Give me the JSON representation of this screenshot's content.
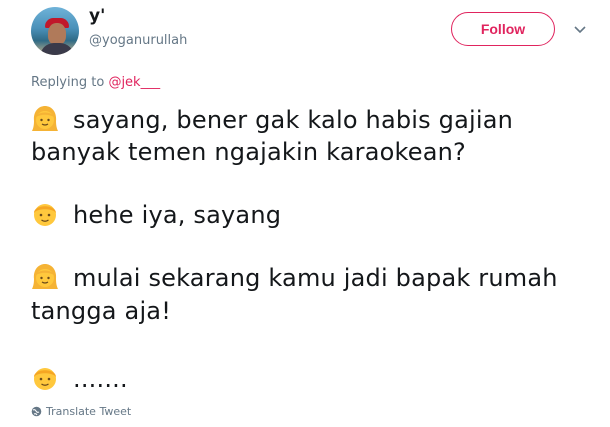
{
  "user": {
    "display_name": "y'",
    "handle": "@yoganurullah"
  },
  "follow_button": {
    "label": "Follow"
  },
  "reply": {
    "prefix": "Replying to",
    "mention": "@jek___"
  },
  "tweet": {
    "lines": [
      {
        "emoji": "girl-emoji",
        "text": "sayang, bener gak kalo habis gajian"
      },
      {
        "emoji": "",
        "text": "banyak temen ngajakin karaokean?"
      },
      {
        "emoji": "boy-emoji",
        "text": "hehe iya, sayang"
      },
      {
        "emoji": "girl-emoji",
        "text": "mulai sekarang kamu jadi bapak rumah"
      },
      {
        "emoji": "",
        "text": "tangga aja!"
      },
      {
        "emoji": "boy-emoji",
        "text": "......."
      }
    ]
  },
  "translate": {
    "label": "Translate Tweet"
  },
  "colors": {
    "accent": "#e0245e",
    "secondary_text": "#657786",
    "primary_text": "#14171a"
  }
}
